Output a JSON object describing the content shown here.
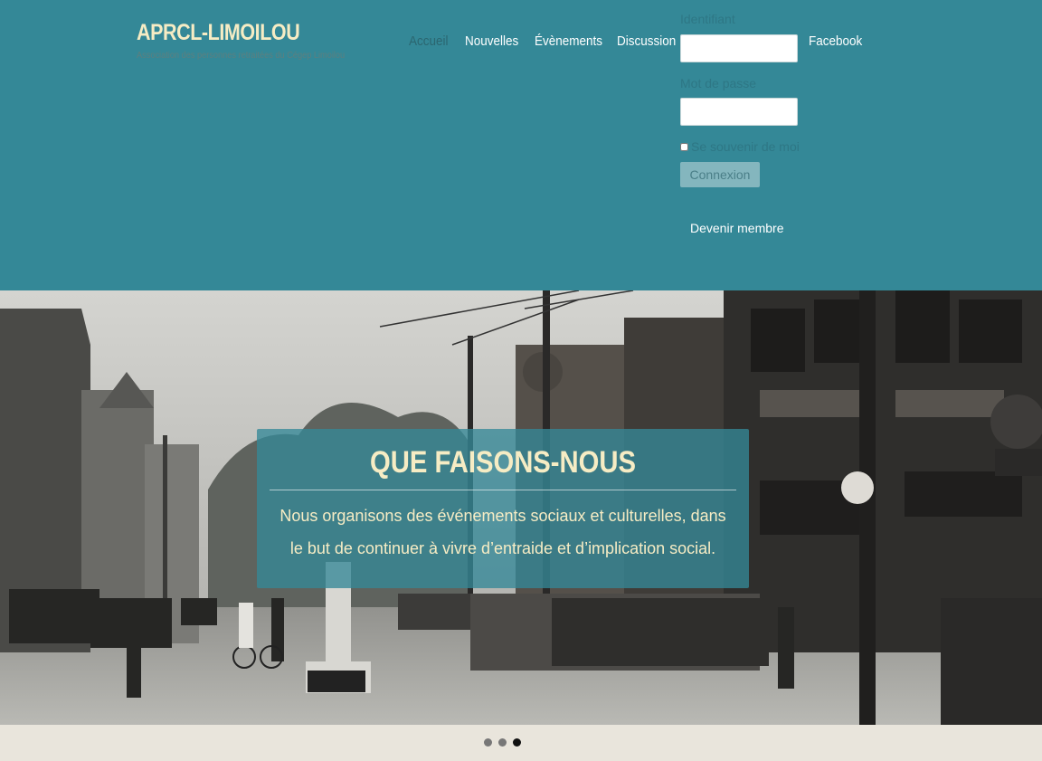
{
  "site": {
    "title": "APRCL-LIMOILOU",
    "subtitle": "Association des personnes retraitées du Cégep Limoilou"
  },
  "nav": {
    "items": [
      "Accueil",
      "Nouvelles",
      "Évènements",
      "Discussion",
      "Facebook"
    ],
    "active": "Accueil"
  },
  "login": {
    "username_label": "Identifiant",
    "username_value": "",
    "password_label": "Mot de passe",
    "password_value": "",
    "remember_label": "Se souvenir de moi",
    "remember_checked": false,
    "submit_label": "Connexion",
    "join_label": "Devenir membre"
  },
  "slider": {
    "title": "QUE FAISONS-NOUS",
    "text": "Nous organisons des événements sociaux et culturelles, dans le but de continuer à vivre d’entraide et d’implication social.",
    "slide_count": 3,
    "active_slide": 3
  },
  "colors": {
    "header_bg": "#348897",
    "title_color": "#f6ecc4",
    "caption_bg": "rgba(52,136,151,0.78)"
  }
}
